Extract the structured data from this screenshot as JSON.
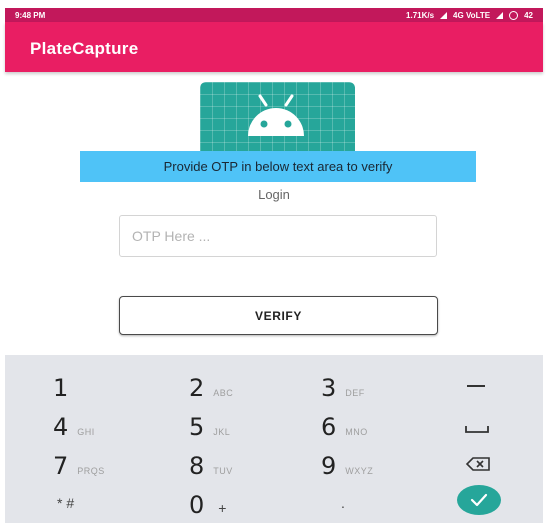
{
  "status_bar": {
    "time": "9:48 PM",
    "network_speed": "1.71K/s",
    "network_type": "4G VoLTE",
    "battery": "42",
    "icons": [
      "signal-icon",
      "battery-icon"
    ]
  },
  "app_bar": {
    "title": "PlateCapture"
  },
  "main": {
    "logo_icon": "android-icon",
    "instruction": "Provide OTP in below text area to verify",
    "login_label": "Login",
    "otp_placeholder": "OTP Here ...",
    "otp_value": "",
    "verify_label": "VERIFY"
  },
  "keypad": {
    "rows": [
      [
        {
          "digit": "1",
          "letters": ""
        },
        {
          "digit": "2",
          "letters": "ABC"
        },
        {
          "digit": "3",
          "letters": "DEF"
        },
        {
          "func": "minus"
        }
      ],
      [
        {
          "digit": "4",
          "letters": "GHI"
        },
        {
          "digit": "5",
          "letters": "JKL"
        },
        {
          "digit": "6",
          "letters": "MNO"
        },
        {
          "func": "space"
        }
      ],
      [
        {
          "digit": "7",
          "letters": "PRQS"
        },
        {
          "digit": "8",
          "letters": "TUV"
        },
        {
          "digit": "9",
          "letters": "WXYZ"
        },
        {
          "func": "backspace"
        }
      ],
      [
        {
          "symbols": "* #"
        },
        {
          "digit": "0",
          "letters": "+"
        },
        {
          "symbols": "."
        },
        {
          "func": "done"
        }
      ]
    ],
    "keys": {
      "k1": "1",
      "k2": "2",
      "k2_letters": "ABC",
      "k3": "3",
      "k3_letters": "DEF",
      "k4": "4",
      "k4_letters": "GHI",
      "k5": "5",
      "k5_letters": "JKL",
      "k6": "6",
      "k6_letters": "MNO",
      "k7": "7",
      "k7_letters": "PRQS",
      "k8": "8",
      "k8_letters": "TUV",
      "k9": "9",
      "k9_letters": "WXYZ",
      "star_hash": "* #",
      "k0": "0",
      "k0_letters": "+",
      "dot": "."
    }
  },
  "colors": {
    "status_bar": "#c2185b",
    "app_bar": "#e91e63",
    "banner": "#4fc3f7",
    "logo_bg": "#26a69a",
    "keypad_bg": "#e3e5ea",
    "done_key": "#26a69a"
  }
}
